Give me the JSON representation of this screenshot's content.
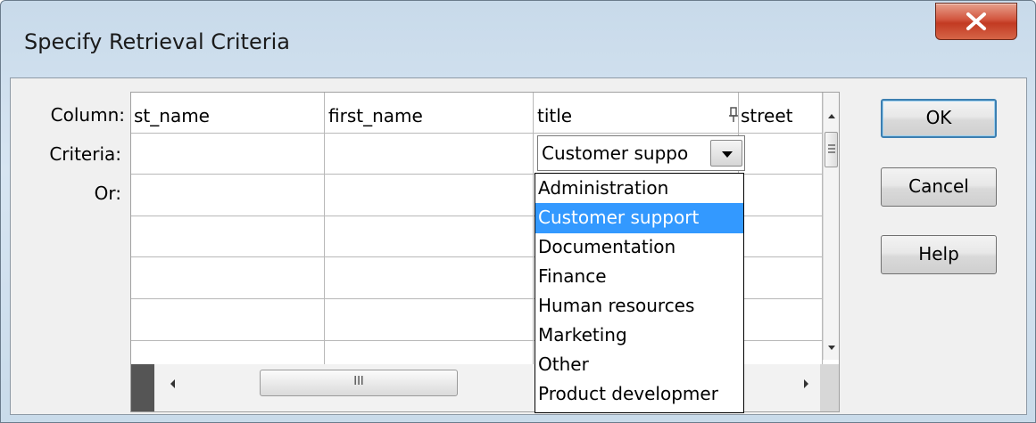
{
  "window": {
    "title": "Specify Retrieval Criteria",
    "close_icon": "close-icon"
  },
  "labels": {
    "column": "Column:",
    "criteria": "Criteria:",
    "or": "Or:"
  },
  "grid": {
    "columns": [
      "st_name",
      "first_name",
      "title",
      "street"
    ],
    "sort_icon": "pin-icon",
    "criteria_value": "Customer suppo",
    "hscroll_thumb_glyph": "III"
  },
  "dropdown": {
    "selected": "Customer support",
    "options": [
      "Administration",
      "Customer support",
      "Documentation",
      "Finance",
      "Human resources",
      "Marketing",
      "Other",
      "Product developmer"
    ]
  },
  "buttons": {
    "ok": "OK",
    "cancel": "Cancel",
    "help": "Help"
  },
  "colors": {
    "selection": "#3399ff",
    "close_button": "#c23a22"
  }
}
